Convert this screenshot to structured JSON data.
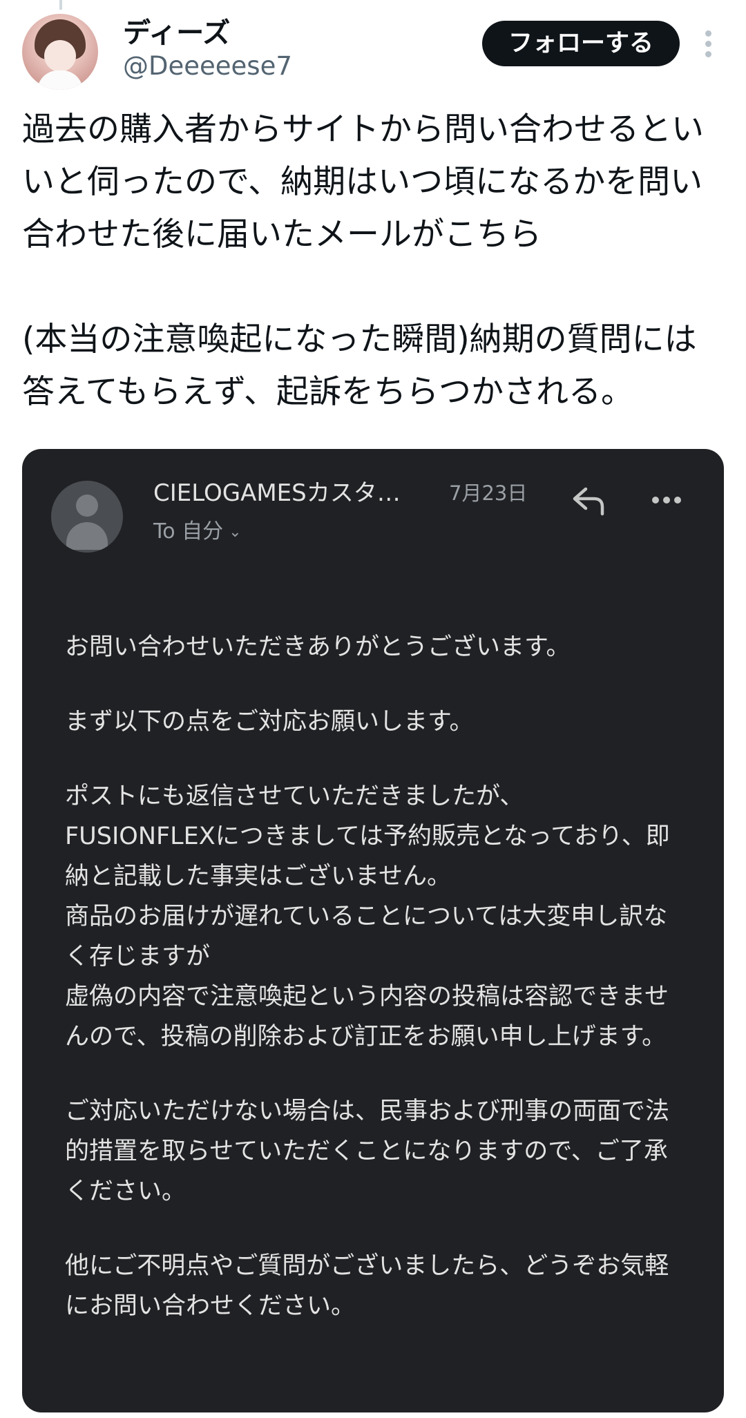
{
  "post": {
    "author_name": "ディーズ",
    "author_handle": "@Deeeeese7",
    "follow_label": "フォローする",
    "paragraphs": [
      "過去の購入者からサイトから問い合わせるといいと伺ったので、納期はいつ頃になるかを問い合わせた後に届いたメールがこちら",
      "(本当の注意喚起になった瞬間)納期の質問には答えてもらえず、起訴をちらつかされる。"
    ]
  },
  "icons": {
    "avatar": "user-avatar",
    "more": "more-vertical-icon",
    "sender_avatar": "default-person-icon",
    "reply": "reply-icon",
    "email_more": "more-horizontal-icon",
    "recipient_expand": "chevron-down-icon"
  },
  "colors": {
    "follow_button_bg": "#0f1419",
    "email_card_bg": "#202124",
    "email_text": "#e3e3e3",
    "email_meta": "#9aa0a6"
  },
  "email": {
    "sender": "CIELOGAMESカスタ…",
    "date": "7月23日",
    "recipient": "To 自分",
    "paragraphs": [
      "お問い合わせいただきありがとうございます。",
      "まず以下の点をご対応お願いします。",
      "ポストにも返信させていただきましたが、\nFUSIONFLEXにつきましては予約販売となっており、即納と記載した事実はございません。\n商品のお届けが遅れていることについては大変申し訳なく存じますが\n虚偽の内容で注意喚起という内容の投稿は容認できませんので、投稿の削除および訂正をお願い申し上げます。",
      "ご対応いただけない場合は、民事および刑事の両面で法的措置を取らせていただくことになりますので、ご了承ください。",
      "他にご不明点やご質問がございましたら、どうぞお気軽にお問い合わせください。"
    ]
  }
}
